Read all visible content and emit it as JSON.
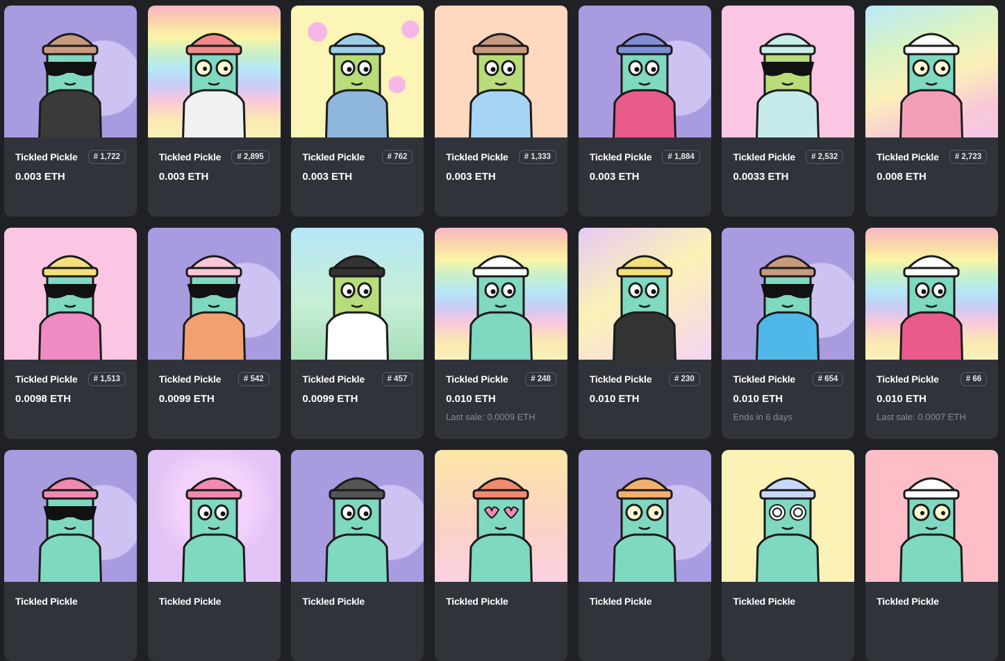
{
  "cards": [
    {
      "name": "Tickled Pickle",
      "token": "# 1,722",
      "price": "0.003 ETH",
      "sub": "",
      "bg": "purple",
      "body": "#7fd8c0",
      "hat": "#c89a80",
      "shirt": "#3a3a3a",
      "glasses": "sunglasses"
    },
    {
      "name": "Tickled Pickle",
      "token": "# 2,895",
      "price": "0.003 ETH",
      "sub": "",
      "bg": "rainbow",
      "body": "#7fd8c0",
      "hat": "#f08a8a",
      "shirt": "#f1f1f1",
      "glasses": "round"
    },
    {
      "name": "Tickled Pickle",
      "token": "# 762",
      "price": "0.003 ETH",
      "sub": "",
      "bg": "yellow",
      "body": "#b9dc7a",
      "hat": "#9fcde8",
      "shirt": "#8fb6dc",
      "glasses": "eyes"
    },
    {
      "name": "Tickled Pickle",
      "token": "# 1,333",
      "price": "0.003 ETH",
      "sub": "",
      "bg": "peach",
      "body": "#b9dc7a",
      "hat": "#c89a80",
      "shirt": "#a6d4f4",
      "glasses": "eyes"
    },
    {
      "name": "Tickled Pickle",
      "token": "# 1,884",
      "price": "0.003 ETH",
      "sub": "",
      "bg": "purple",
      "body": "#7fd8c0",
      "hat": "#7f8fd6",
      "shirt": "#e85b8a",
      "glasses": "eyes"
    },
    {
      "name": "Tickled Pickle",
      "token": "# 2,532",
      "price": "0.0033 ETH",
      "sub": "",
      "bg": "pink",
      "body": "#b9dc7a",
      "hat": "#c8eee8",
      "shirt": "#c6eae9",
      "glasses": "sunglasses"
    },
    {
      "name": "Tickled Pickle",
      "token": "# 2,723",
      "price": "0.008 ETH",
      "sub": "",
      "bg": "pastel",
      "body": "#7fd8c0",
      "hat": "#ffffff",
      "shirt": "#f49fb8",
      "glasses": "round"
    },
    {
      "name": "Tickled Pickle",
      "token": "# 1,513",
      "price": "0.0098 ETH",
      "sub": "",
      "bg": "pink",
      "body": "#7fd8c0",
      "hat": "#f4e07a",
      "shirt": "#f08ac4",
      "glasses": "sunglasses"
    },
    {
      "name": "Tickled Pickle",
      "token": "# 542",
      "price": "0.0099 ETH",
      "sub": "",
      "bg": "purple",
      "body": "#7fd8c0",
      "hat": "#f9c7d8",
      "shirt": "#f2a070",
      "glasses": "sunglasses"
    },
    {
      "name": "Tickled Pickle",
      "token": "# 457",
      "price": "0.0099 ETH",
      "sub": "",
      "bg": "sky",
      "body": "#b9dc7a",
      "hat": "#333333",
      "shirt": "#ffffff",
      "glasses": "eyes"
    },
    {
      "name": "Tickled Pickle",
      "token": "# 248",
      "price": "0.010 ETH",
      "sub": "Last sale: 0.0009 ETH",
      "bg": "rainbow",
      "body": "#7fd8c0",
      "hat": "#ffffff",
      "shirt": "#7fd8c0",
      "glasses": "eyes"
    },
    {
      "name": "Tickled Pickle",
      "token": "# 230",
      "price": "0.010 ETH",
      "sub": "",
      "bg": "yellow2",
      "body": "#7fd8c0",
      "hat": "#f4e07a",
      "shirt": "#333333",
      "glasses": "eyes"
    },
    {
      "name": "Tickled Pickle",
      "token": "# 654",
      "price": "0.010 ETH",
      "sub": "Ends in 6 days",
      "bg": "purple",
      "body": "#7fd8c0",
      "hat": "#c89a80",
      "shirt": "#4fb8e8",
      "glasses": "sunglasses"
    },
    {
      "name": "Tickled Pickle",
      "token": "# 66",
      "price": "0.010 ETH",
      "sub": "Last sale: 0.0007 ETH",
      "bg": "rainbow",
      "body": "#7fd8c0",
      "hat": "#ffffff",
      "shirt": "#e85b8a",
      "glasses": "eyes"
    },
    {
      "name": "Tickled Pickle",
      "token": "",
      "price": "",
      "sub": "",
      "bg": "purple",
      "body": "#7fd8c0",
      "hat": "#f08ab0",
      "shirt": "#7fd8c0",
      "glasses": "sunglasses"
    },
    {
      "name": "Tickled Pickle",
      "token": "",
      "price": "",
      "sub": "",
      "bg": "lavender",
      "body": "#7fd8c0",
      "hat": "#f08ab0",
      "shirt": "#7fd8c0",
      "glasses": "eyes"
    },
    {
      "name": "Tickled Pickle",
      "token": "",
      "price": "",
      "sub": "",
      "bg": "purple",
      "body": "#7fd8c0",
      "hat": "#555555",
      "shirt": "#7fd8c0",
      "glasses": "eyes"
    },
    {
      "name": "Tickled Pickle",
      "token": "",
      "price": "",
      "sub": "",
      "bg": "pastel2",
      "body": "#7fd8c0",
      "hat": "#f08a70",
      "shirt": "#7fd8c0",
      "glasses": "hearts"
    },
    {
      "name": "Tickled Pickle",
      "token": "",
      "price": "",
      "sub": "",
      "bg": "purple",
      "body": "#7fd8c0",
      "hat": "#f2b070",
      "shirt": "#7fd8c0",
      "glasses": "round"
    },
    {
      "name": "Tickled Pickle",
      "token": "",
      "price": "",
      "sub": "",
      "bg": "cream",
      "body": "#7fd8c0",
      "hat": "#c8d8f8",
      "shirt": "#7fd8c0",
      "glasses": "spirals"
    },
    {
      "name": "Tickled Pickle",
      "token": "",
      "price": "",
      "sub": "",
      "bg": "rose",
      "body": "#7fd8c0",
      "hat": "#ffffff",
      "shirt": "#7fd8c0",
      "glasses": "round"
    }
  ]
}
